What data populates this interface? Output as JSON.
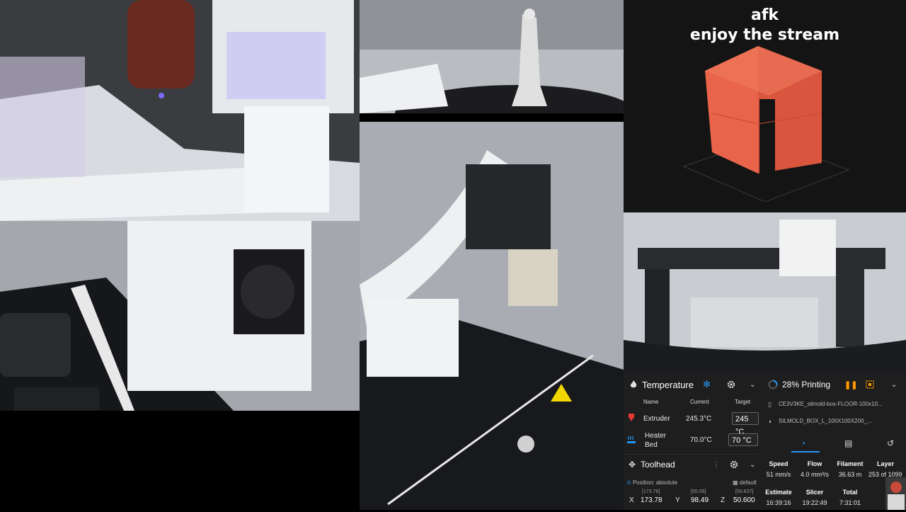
{
  "overlay": {
    "line1": "afk",
    "line2": "enjoy the stream"
  },
  "temperature": {
    "title": "Temperature",
    "columns": {
      "name": "Name",
      "current": "Current",
      "target": "Target"
    },
    "rows": [
      {
        "name": "Extruder",
        "current": "245.3°C",
        "target": "245",
        "unit": "°C"
      },
      {
        "name_line1": "Heater",
        "name_line2": "Bed",
        "current": "70.0°C",
        "target": "70",
        "unit": "°C"
      }
    ]
  },
  "toolhead": {
    "title": "Toolhead",
    "position_label": "Position: absolute",
    "profile": "default",
    "axes": [
      {
        "axis": "X",
        "value": "173.78",
        "hint": "[173.78]"
      },
      {
        "axis": "Y",
        "value": "98.49",
        "hint": "[65.06]"
      },
      {
        "axis": "Z",
        "value": "50.600",
        "hint": "[50.637]"
      }
    ]
  },
  "status": {
    "title": "28% Printing",
    "progress_percent": 28,
    "files": [
      "CE3V3KE_silmold-box-FLOOR-100x10...",
      "SILMOLD_BOX_L_100X100X200_..."
    ],
    "stats_row1": [
      {
        "k": "Speed",
        "v": "51 mm/s"
      },
      {
        "k": "Flow",
        "v": "4.0 mm³/s"
      },
      {
        "k": "Filament",
        "v": "36.63 m"
      },
      {
        "k": "Layer",
        "v": "253 of 1099"
      }
    ],
    "stats_row2": [
      {
        "k": "Estimate",
        "v": "16:39:16"
      },
      {
        "k": "Slicer",
        "v": "19:22:49"
      },
      {
        "k": "Total",
        "v": "7:31:01"
      }
    ]
  },
  "icons": {
    "snowflake": "snowflake-icon",
    "gear": "gear-icon",
    "chevron": "chevron-down-icon",
    "pause": "pause-icon",
    "stop": "stop-icon",
    "file": "file-icon",
    "spool": "spool-icon",
    "speedometer": "speedometer-icon",
    "doc": "document-icon",
    "history": "history-icon",
    "move": "move-icon",
    "fire": "fire-icon",
    "bed": "bed-icon"
  },
  "colors": {
    "accent": "#2196f3",
    "warning": "#ff9800",
    "model_red": "#e9644a"
  }
}
